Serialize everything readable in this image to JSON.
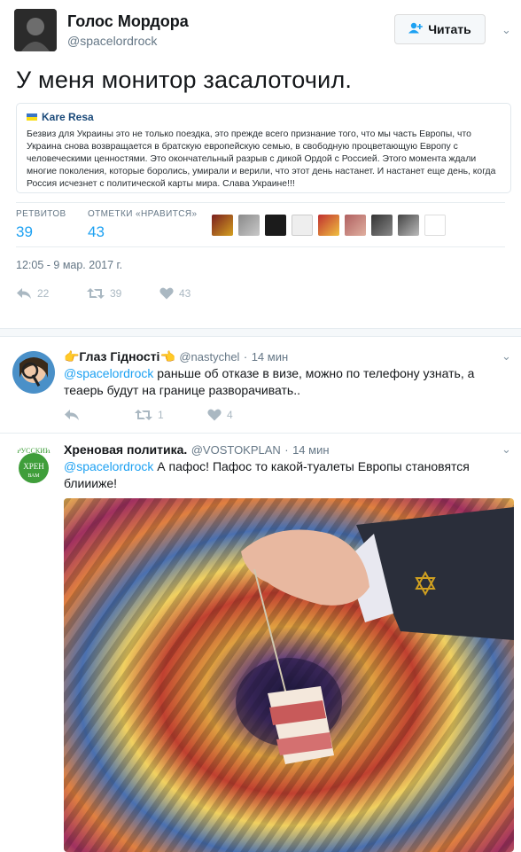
{
  "header": {
    "name": "Голос Мордора",
    "handle": "@spacelordrock",
    "follow_label": "Читать"
  },
  "tweet": {
    "text": "У меня монитор засалоточил.",
    "quote": {
      "author": "Kare Resa",
      "text": "Безвиз для Украины это не только поездка, это прежде всего признание того, что мы часть Европы, что Украина снова возвращается в братскую европейскую семью, в свободную процветающую Европу с человеческими ценностями. Это окончательный разрыв с дикой Ордой с Россией. Этого момента ждали многие поколения, которые боролись, умирали и верили, что этот день настанет. И настанет еще день, когда Россия исчезнет с политической карты мира. Слава Украине!!!"
    },
    "stats": {
      "retweets_label": "РЕТВИТОВ",
      "retweets": "39",
      "likes_label": "ОТМЕТКИ «НРАВИТСЯ»",
      "likes": "43"
    },
    "timestamp": "12:05 - 9 мар. 2017 г.",
    "actions": {
      "replies": "22",
      "retweets": "39",
      "likes": "43"
    }
  },
  "replies": [
    {
      "name": "👉Глаз Гідності👈",
      "handle": "@nastychel",
      "time": "14 мин",
      "mention": "@spacelordrock",
      "text": " раньше об отказе в визе, можно по телефону узнать, а теаерь будут на границе разворачивать..",
      "retweets": "1",
      "likes": "4"
    },
    {
      "name": "Хреновая политика.",
      "handle": "@VOSTOKPLAN",
      "time": "14 мин",
      "mention": "@spacelordrock",
      "text": " А пафос! Пафос то какой-туалеты Европы становятся блиииже!",
      "avatar_text": [
        "РУССКИЙ",
        "ХРЕН",
        "ВАМ"
      ]
    }
  ],
  "colors": {
    "accent": "#1da1f2",
    "muted": "#657786",
    "icon": "#aab8c2"
  }
}
